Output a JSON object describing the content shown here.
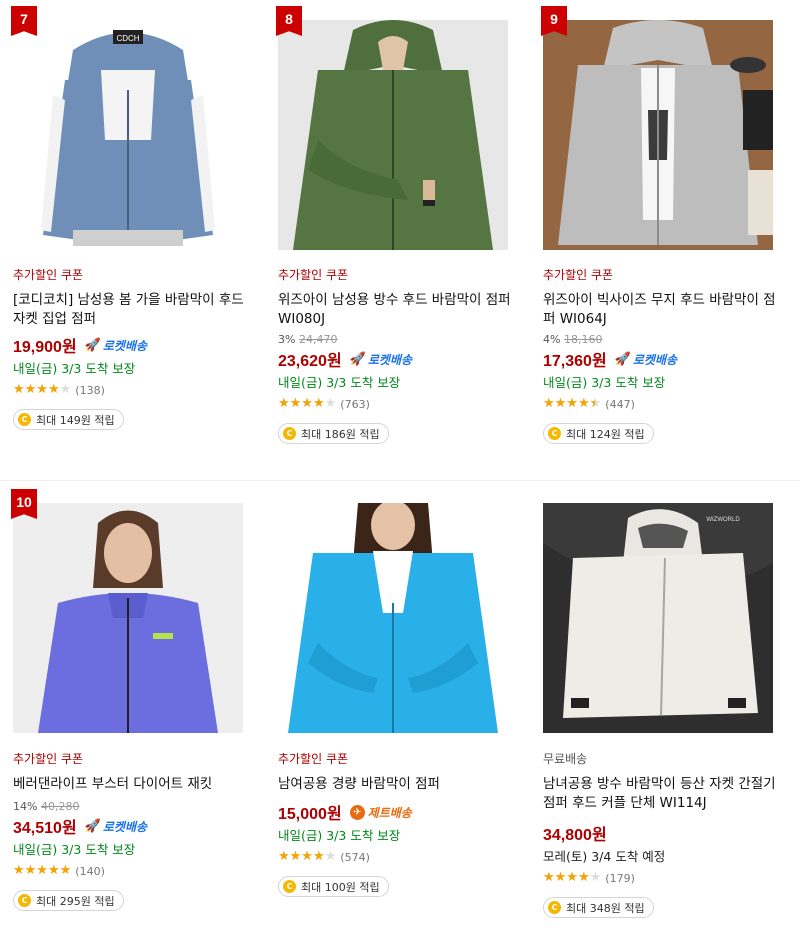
{
  "products": [
    {
      "rank": "7",
      "coupon": "추가할인 쿠폰",
      "title": "[코디코치] 남성용 봄 가을 바람막이 후드 자켓 집업 점퍼",
      "discount": "",
      "original_price": "",
      "price": "19,900원",
      "delivery_badge": "로켓배송",
      "arrival": "내일(금) 3/3 도착 보장",
      "rating": 4.0,
      "review_count": "(138)",
      "cashback": "최대 149원 적립",
      "image_logo": "CDCH",
      "colors": {
        "jacket": "#6f8fb8",
        "bg": "#ffffff"
      }
    },
    {
      "rank": "8",
      "coupon": "추가할인 쿠폰",
      "title": "위즈아이 남성용 방수 후드 바람막이 점퍼 WI080J",
      "discount": "3%",
      "original_price": "24,470",
      "price": "23,620원",
      "delivery_badge": "로켓배송",
      "arrival": "내일(금) 3/3 도착 보장",
      "rating": 4.0,
      "review_count": "(763)",
      "cashback": "최대 186원 적립",
      "colors": {
        "jacket": "#4f6f3c",
        "bg": "#e7e7e7"
      }
    },
    {
      "rank": "9",
      "coupon": "추가할인 쿠폰",
      "title": "위즈아이 빅사이즈 무지 후드 바람막이 점퍼 WI064J",
      "discount": "4%",
      "original_price": "18,160",
      "price": "17,360원",
      "delivery_badge": "로켓배송",
      "arrival": "내일(금) 3/3 도착 보장",
      "rating": 4.5,
      "review_count": "(447)",
      "cashback": "최대 124원 적립",
      "colors": {
        "jacket": "#bdbdbd",
        "bg": "#9a6a45"
      }
    },
    {
      "rank": "10",
      "coupon": "추가할인 쿠폰",
      "title": "베러댄라이프 부스터 다이어트 재킷",
      "discount": "14%",
      "original_price": "40,280",
      "price": "34,510원",
      "delivery_badge": "로켓배송",
      "arrival": "내일(금) 3/3 도착 보장",
      "rating": 5.0,
      "review_count": "(140)",
      "cashback": "최대 295원 적립",
      "colors": {
        "jacket": "#6c6ee0",
        "bg": "#eeeeee"
      }
    },
    {
      "rank": "",
      "coupon": "추가할인 쿠폰",
      "title": "남여공용 경량 바람막이 점퍼",
      "discount": "",
      "original_price": "",
      "price": "15,000원",
      "delivery_badge": "제트배송",
      "arrival": "내일(금) 3/3 도착 보장",
      "rating": 4.0,
      "review_count": "(574)",
      "cashback": "최대 100원 적립",
      "colors": {
        "jacket": "#29b0e8",
        "bg": "#ffffff"
      }
    },
    {
      "rank": "",
      "coupon": "무료배송",
      "title": "남녀공용 방수 바람막이 등산 자켓 간절기 점퍼 후드 커플 단체 WI114J",
      "discount": "",
      "original_price": "",
      "price": "34,800원",
      "delivery_badge": "",
      "arrival": "모레(토) 3/4 도착 예정",
      "rating": 4.0,
      "review_count": "(179)",
      "cashback": "최대 348원 적립",
      "image_logo": "WIZWORLD",
      "colors": {
        "jacket": "#eeece6",
        "bg": "#2e2e2e"
      }
    }
  ]
}
